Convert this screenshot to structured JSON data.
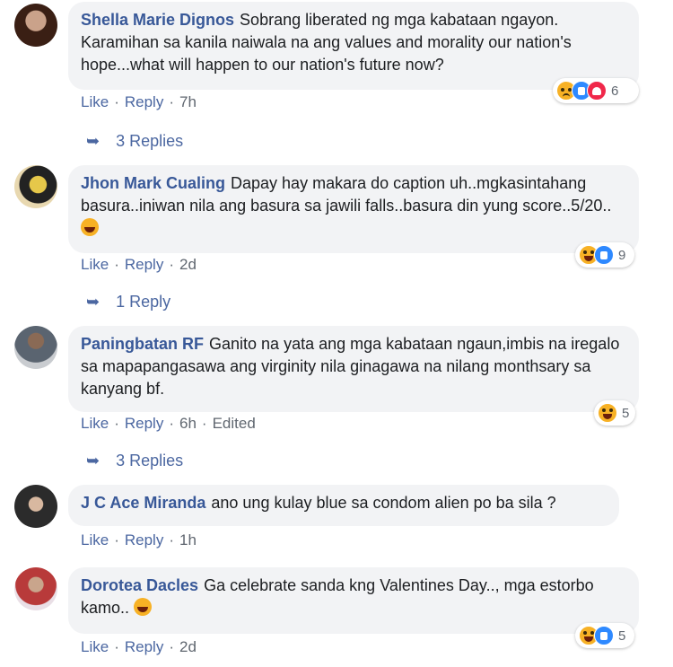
{
  "comments": [
    {
      "name": "Shella Marie Dignos",
      "text": "Sobrang liberated ng mga kabataan ngayon. Karamihan sa kanila naiwala na ang values and morality our nation's hope...what will happen to our nation's future now?",
      "like": "Like",
      "reply": "Reply",
      "time": "7h",
      "reactions": [
        "sad",
        "like",
        "love"
      ],
      "reaction_count": "6",
      "replies": "3 Replies"
    },
    {
      "name": "Jhon Mark Cualing",
      "text": "Dapay hay makara do caption uh..mgkasintahang basura..iniwan nila ang basura sa jawili falls..basura din yung score..5/20..",
      "like": "Like",
      "reply": "Reply",
      "time": "2d",
      "reactions": [
        "haha",
        "like"
      ],
      "reaction_count": "9",
      "replies": "1 Reply"
    },
    {
      "name": "Paningbatan RF",
      "text": "Ganito na yata ang mga kabataan ngaun,imbis na iregalo sa mapapangasawa ang virginity nila ginagawa na nilang monthsary sa kanyang bf.",
      "like": "Like",
      "reply": "Reply",
      "time": "6h",
      "edited": "Edited",
      "reactions": [
        "haha"
      ],
      "reaction_count": "5",
      "replies": "3 Replies"
    },
    {
      "name": "J C Ace Miranda",
      "text": "ano ung kulay blue sa condom alien po ba sila ?",
      "like": "Like",
      "reply": "Reply",
      "time": "1h"
    },
    {
      "name": "Dorotea Dacles",
      "text": "Ga celebrate sanda kng Valentines Day.., mga estorbo kamo..",
      "like": "Like",
      "reply": "Reply",
      "time": "2d",
      "reactions": [
        "haha",
        "like"
      ],
      "reaction_count": "5"
    }
  ],
  "colors": {
    "name": "#385898",
    "link": "#4b67a1",
    "bubble": "#f2f3f5",
    "text": "#1c1e21",
    "meta": "#606770"
  }
}
